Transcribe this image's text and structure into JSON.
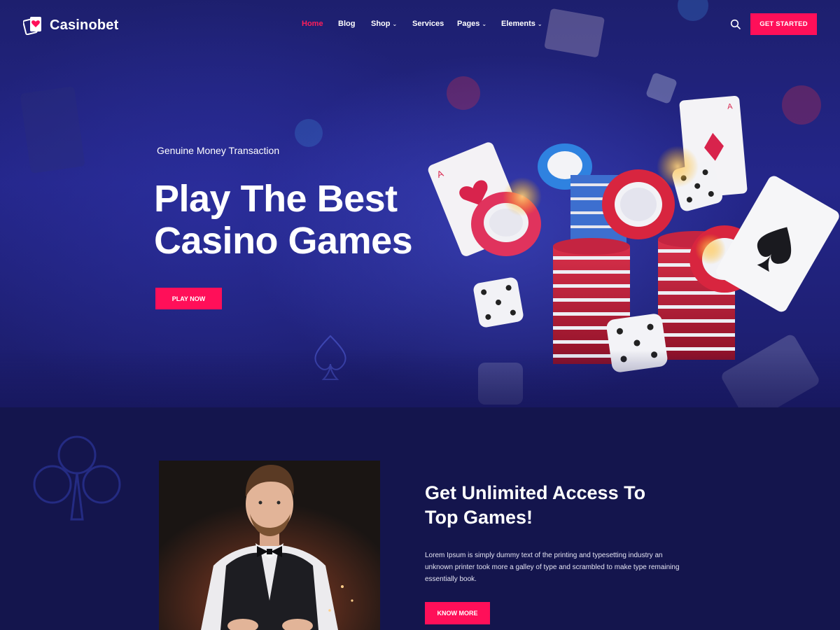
{
  "header": {
    "logo_text": "Casinobet",
    "nav": [
      {
        "label": "Home",
        "active": true,
        "has_dropdown": false
      },
      {
        "label": "Blog",
        "active": false,
        "has_dropdown": false
      },
      {
        "label": "Shop",
        "active": false,
        "has_dropdown": true
      },
      {
        "label": "Services",
        "active": false,
        "has_dropdown": false
      },
      {
        "label": "Pages",
        "active": false,
        "has_dropdown": true
      },
      {
        "label": "Elements",
        "active": false,
        "has_dropdown": true
      }
    ],
    "cta_label": "GET STARTED",
    "search_icon": "search-icon"
  },
  "hero": {
    "kicker": "Genuine Money Transaction",
    "title_line1": "Play The Best",
    "title_line2": "Casino Games",
    "cta_label": "PLAY NOW"
  },
  "about": {
    "title_line1": "Get Unlimited Access To",
    "title_line2": "Top Games!",
    "body": "Lorem Ipsum is simply dummy text of the printing and typesetting industry an unknown printer took more a galley of type and scrambled to make type remaining essentially book.",
    "cta_label": "KNOW MORE"
  },
  "colors": {
    "accent": "#ff0f59",
    "background": "#14154d",
    "hero_background": "#24268a"
  }
}
